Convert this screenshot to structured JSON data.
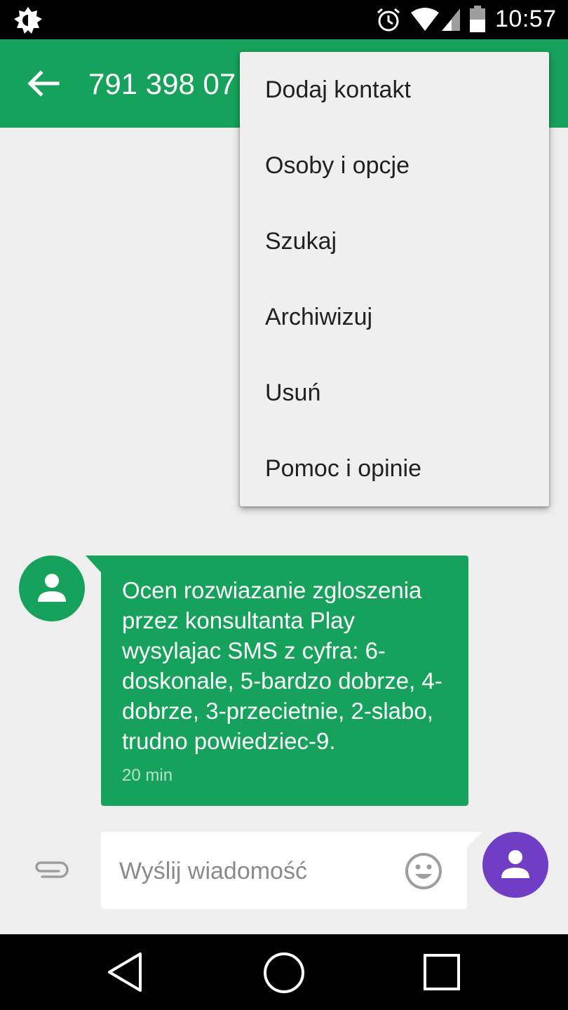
{
  "status_bar": {
    "time": "10:57",
    "icons": [
      "brightness-icon",
      "alarm-icon",
      "wifi-icon",
      "signal-icon",
      "battery-icon"
    ]
  },
  "toolbar": {
    "title": "791 398 07",
    "back_icon": "arrow-back-icon",
    "color": "#16a25d"
  },
  "menu": {
    "items": [
      "Dodaj kontakt",
      "Osoby i opcje",
      "Szukaj",
      "Archiwizuj",
      "Usuń",
      "Pomoc i opinie"
    ]
  },
  "conversation": {
    "messages": [
      {
        "text": "Ocen rozwiazanie zgloszenia przez konsultanta Play wysylajac SMS z cyfra: 6-doskonale, 5-bardzo dobrze, 4-dobrze, 3-przecietnie, 2-slabo, trudno powiedziec-9.",
        "time": "20 min",
        "avatar_color": "#16a25d"
      }
    ]
  },
  "compose": {
    "placeholder": "Wyślij wiadomość",
    "value": "",
    "send_avatar_color": "#6f3ec4"
  },
  "nav_bar": {
    "icons": [
      "nav-back-icon",
      "nav-home-icon",
      "nav-recents-icon"
    ]
  }
}
